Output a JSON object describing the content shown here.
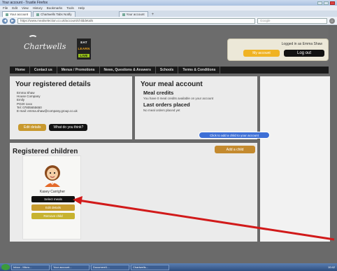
{
  "browser": {
    "title": "Your account - Trustle Firefox",
    "menu": [
      "File",
      "Edit",
      "View",
      "History",
      "Bookmarks",
      "Tools",
      "Help"
    ],
    "tabs": [
      {
        "label": "Your account",
        "active": true
      },
      {
        "label": "Chartwells Tabs Notify",
        "active": false
      },
      {
        "label": "Your account",
        "active": false
      }
    ],
    "new_tab": "+",
    "url": "https://www.mealselection.co.uk/account/childdetails",
    "search_placeholder": "Google"
  },
  "site": {
    "logo_text": "Chartwells",
    "eat": "EAT",
    "learn": "LEARN",
    "live": "LIVE",
    "logged_in_as": "Logged in as Emma Shaw",
    "my_account_label": "My account",
    "logout_label": "Log out",
    "nav": [
      "Home",
      "Contact us",
      "Menus / Promotions",
      "News, Questions & Answers",
      "Schools",
      "Terms & Conditions"
    ]
  },
  "registered_details": {
    "heading": "Your registered details",
    "lines": [
      "Emma Shaw",
      "House Company",
      "Emily",
      "PO20 1xxx",
      "Tel: 07805655650",
      "E-mail: emma.shaw@company.group.co.uk"
    ],
    "edit_label": "Edit details",
    "feedback_label": "What do you think?"
  },
  "meal_account": {
    "heading": "Your meal account",
    "credits_heading": "Meal credits",
    "credits_text": "You have 0 meal credits available on your account",
    "last_orders_heading": "Last orders placed",
    "last_orders_text": "No meal orders placed yet"
  },
  "tooltip_text": "Click to add a child to your account",
  "add_child_label": "Add a child",
  "children": {
    "heading": "Registered children",
    "items": [
      {
        "name": "Kasey Carrigher",
        "select_label": "Select meals",
        "edit_label": "Edit details",
        "third_label": "Remove child"
      }
    ]
  },
  "taskbar": {
    "items": [
      "Inbox - Micro...",
      "Your account...",
      "Document1...",
      "Chartwells..."
    ],
    "clock": "10:42"
  },
  "colors": {
    "gold": "#c8992e",
    "dark": "#111111",
    "blue_tooltip": "#3d6fd6",
    "arrow_red": "#d11a1a"
  }
}
